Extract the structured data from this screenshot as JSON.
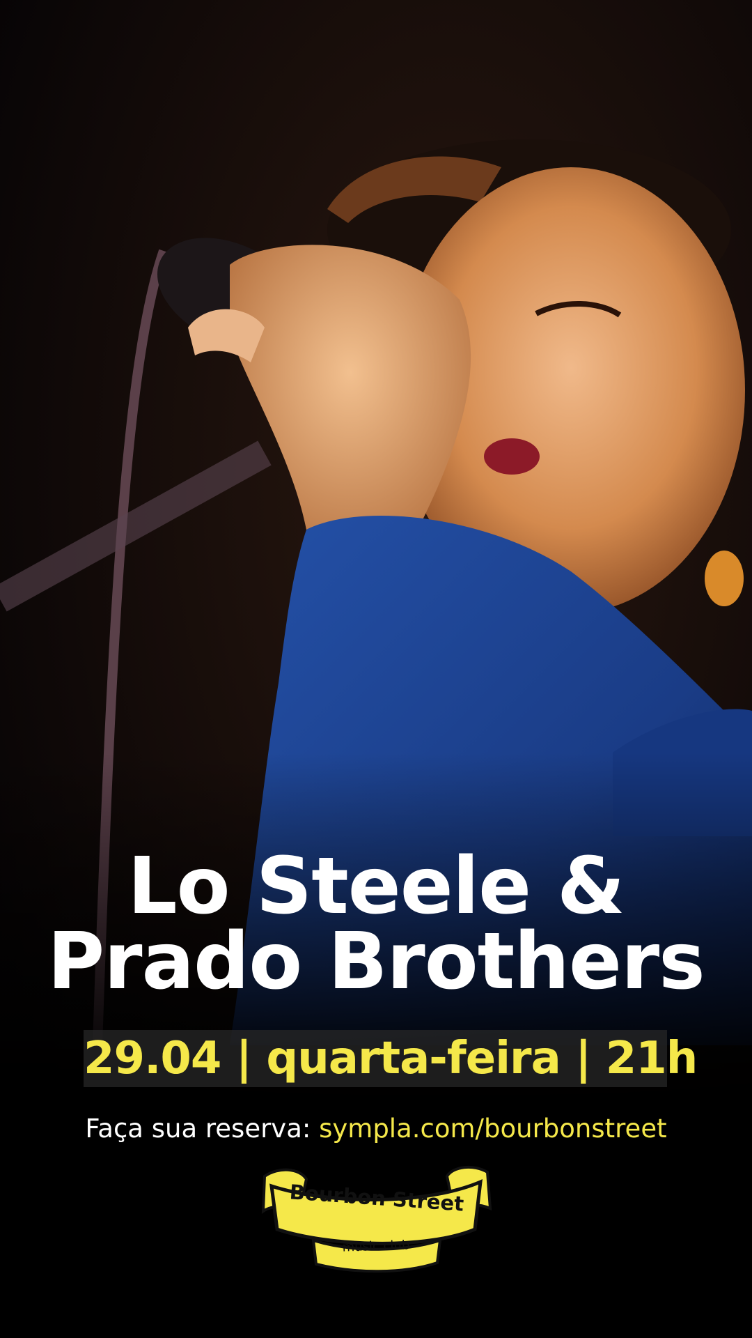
{
  "event": {
    "artist_line1": "Lo Steele &",
    "artist_line2": "Prado Brothers",
    "date_line": "29.04 | quarta-feira | 21h"
  },
  "reservation": {
    "label": "Faça sua reserva:",
    "url": "sympla.com/bourbonstreet"
  },
  "logo": {
    "name": "Bourbon Street",
    "tagline": "music club"
  },
  "colors": {
    "background": "#000000",
    "title": "#ffffff",
    "accent_yellow": "#f5e84a",
    "jacket_blue": "#1b3f8c",
    "skin": "#d9955a"
  }
}
